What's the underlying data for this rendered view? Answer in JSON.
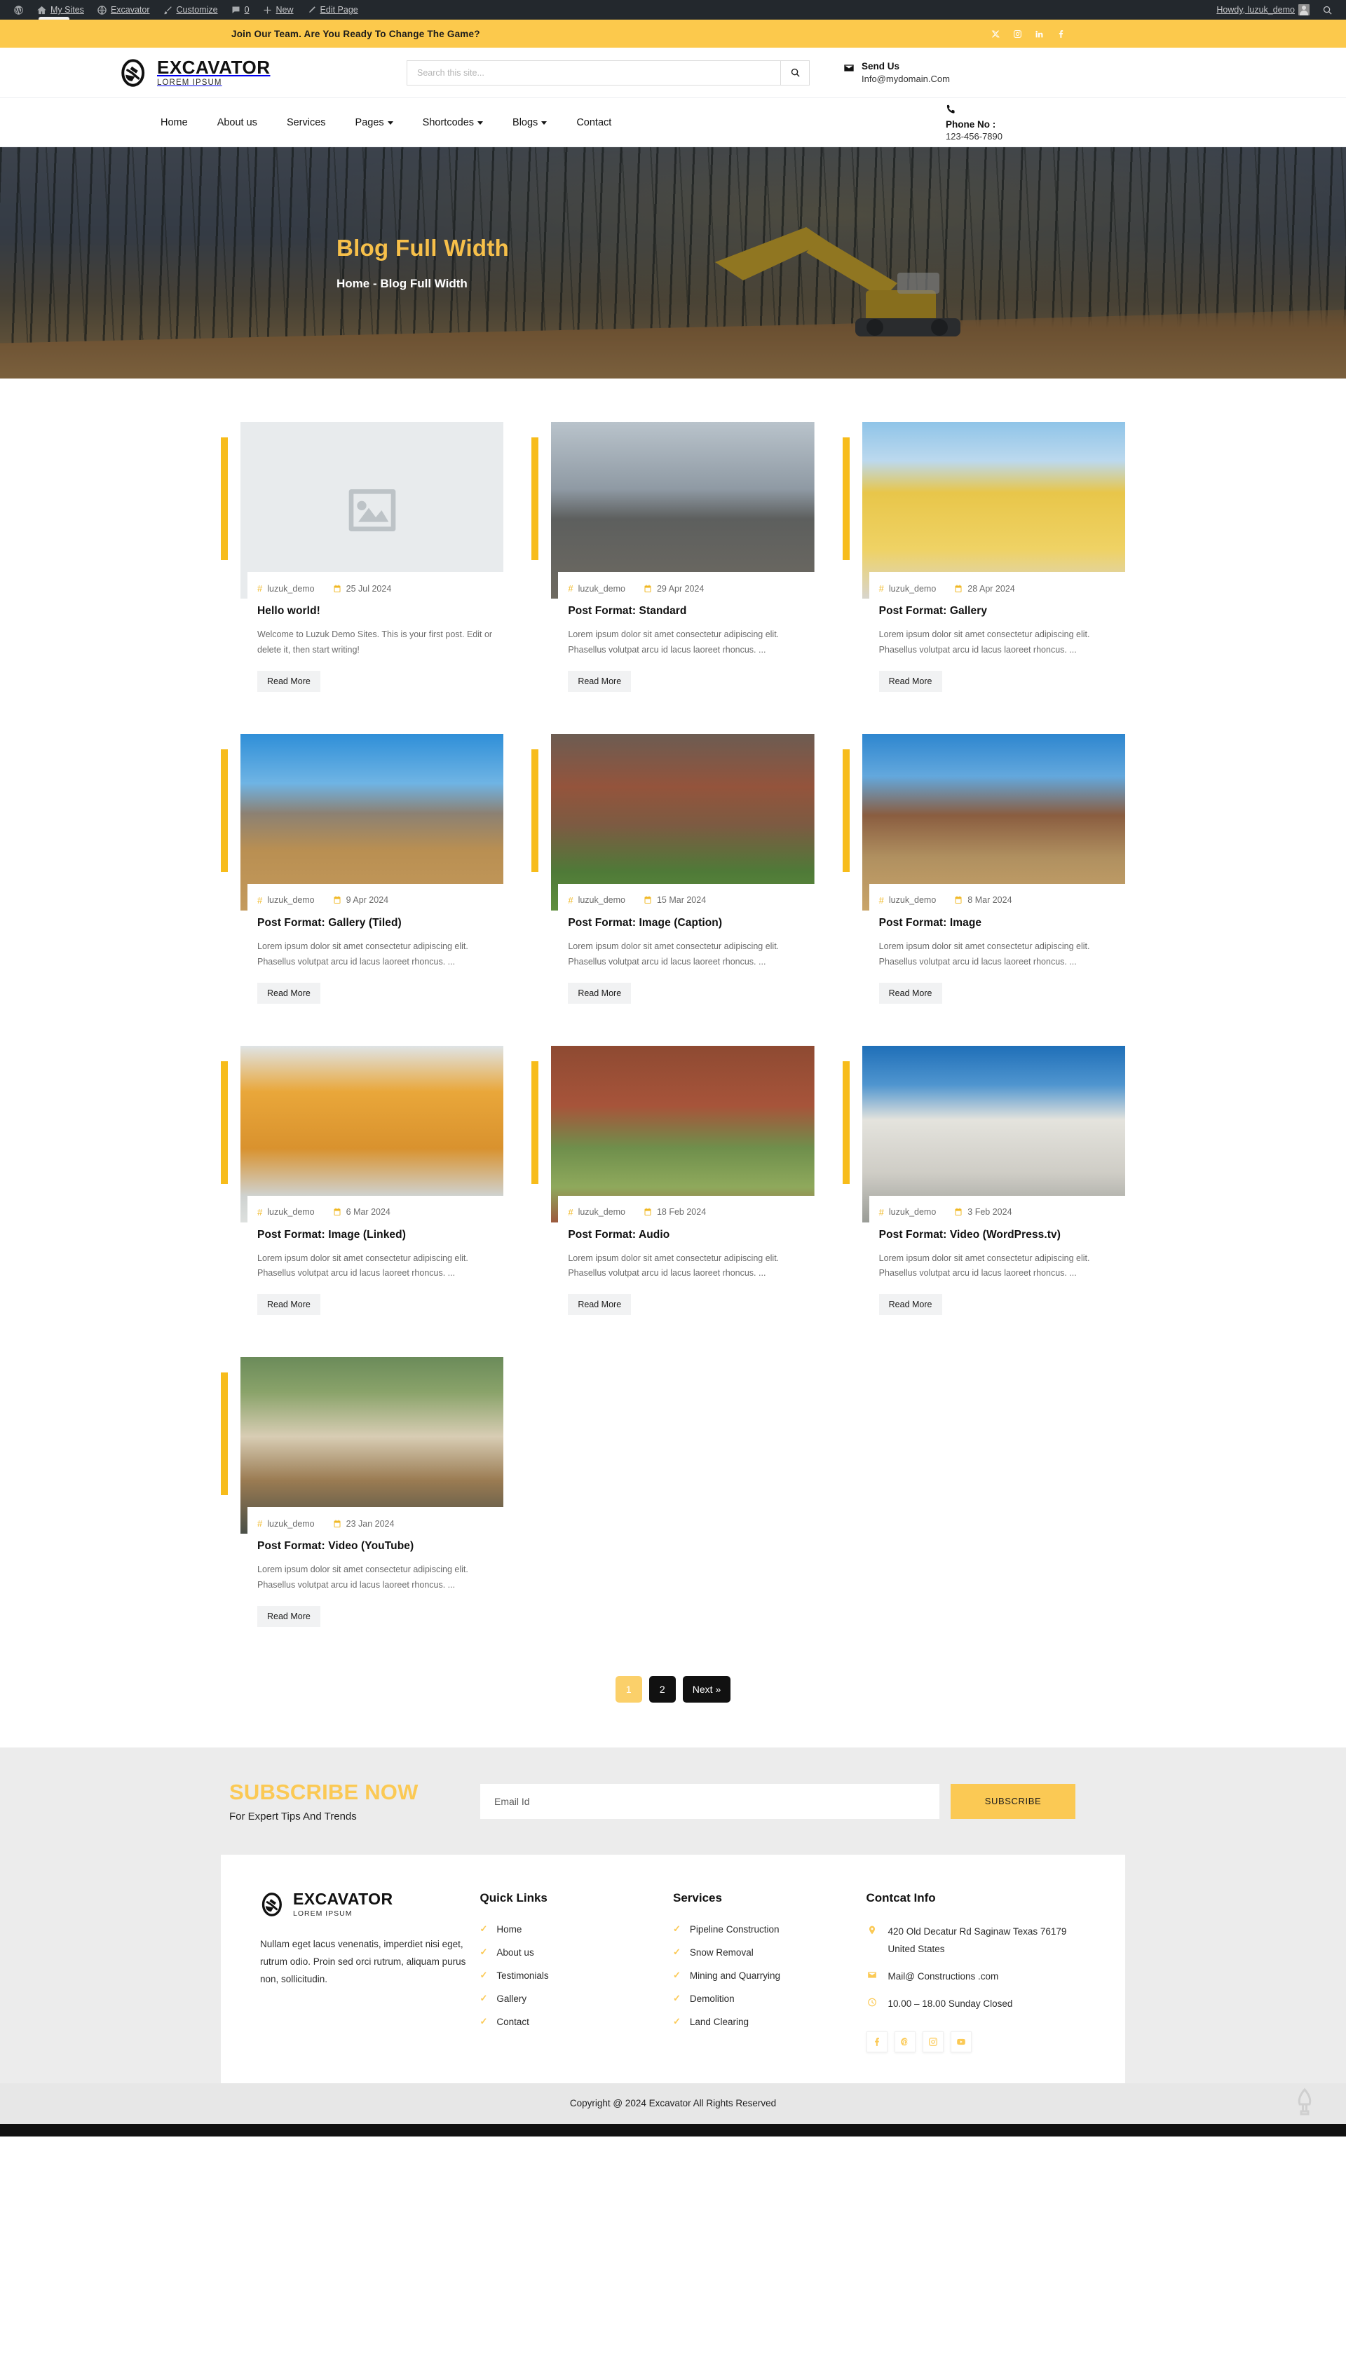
{
  "adminbar": {
    "items": [
      {
        "icon": "wordpress-icon",
        "label": ""
      },
      {
        "icon": "home-icon",
        "label": "My Sites"
      },
      {
        "icon": "site-icon",
        "label": "Excavator"
      },
      {
        "icon": "brush-icon",
        "label": "Customize"
      },
      {
        "icon": "comment-icon",
        "label": "0"
      },
      {
        "icon": "plus-icon",
        "label": "New"
      },
      {
        "icon": "pencil-icon",
        "label": "Edit Page"
      }
    ],
    "howdy": "Howdy, luzuk_demo",
    "search_icon": "search-icon"
  },
  "topbar": {
    "message": "Join Our Team. Are You Ready To Change The Game?",
    "socials": [
      "x-icon",
      "instagram-icon",
      "linkedin-icon",
      "facebook-icon"
    ]
  },
  "header": {
    "brand_name": "EXCAVATOR",
    "brand_sub": "LOREM IPSUM",
    "search_placeholder": "Search this site...",
    "search_value": "",
    "search_icon": "search-icon",
    "email_label": "Send Us",
    "email_value": "Info@mydomain.Com",
    "mail_icon": "envelope-icon"
  },
  "nav": {
    "items": [
      {
        "label": "Home",
        "has_dropdown": false
      },
      {
        "label": "About us",
        "has_dropdown": false
      },
      {
        "label": "Services",
        "has_dropdown": false
      },
      {
        "label": "Pages",
        "has_dropdown": true
      },
      {
        "label": "Shortcodes",
        "has_dropdown": true
      },
      {
        "label": "Blogs",
        "has_dropdown": true
      },
      {
        "label": "Contact",
        "has_dropdown": false
      }
    ],
    "phone_label": "Phone No :",
    "phone_value": "123-456-7890",
    "phone_icon": "phone-icon"
  },
  "hero": {
    "title": "Blog Full Width",
    "breadcrumb": "Home - Blog Full Width"
  },
  "posts": [
    {
      "author": "luzuk_demo",
      "date": "25 Jul 2024",
      "title": "Hello world!",
      "excerpt": "Welcome to Luzuk Demo Sites. This is your first post. Edit or delete it, then start writing!",
      "read_more": "Read More",
      "thumb": "placeholder"
    },
    {
      "author": "luzuk_demo",
      "date": "29 Apr 2024",
      "title": "Post Format: Standard",
      "excerpt": "Lorem ipsum dolor sit amet consectetur adipiscing elit. Phasellus volutpat arcu id lacus laoreet rhoncus. ...",
      "read_more": "Read More",
      "thumb": "construction-workers"
    },
    {
      "author": "luzuk_demo",
      "date": "28 Apr 2024",
      "title": "Post Format: Gallery",
      "excerpt": "Lorem ipsum dolor sit amet consectetur adipiscing elit. Phasellus volutpat arcu id lacus laoreet rhoncus. ...",
      "read_more": "Read More",
      "thumb": "yellow-building"
    },
    {
      "author": "luzuk_demo",
      "date": "9 Apr 2024",
      "title": "Post Format: Gallery (Tiled)",
      "excerpt": "Lorem ipsum dolor sit amet consectetur adipiscing elit. Phasellus volutpat arcu id lacus laoreet rhoncus. ...",
      "read_more": "Read More",
      "thumb": "grey-house"
    },
    {
      "author": "luzuk_demo",
      "date": "15 Mar 2024",
      "title": "Post Format: Image (Caption)",
      "excerpt": "Lorem ipsum dolor sit amet consectetur adipiscing elit. Phasellus volutpat arcu id lacus laoreet rhoncus. ...",
      "read_more": "Read More",
      "thumb": "brick-houses"
    },
    {
      "author": "luzuk_demo",
      "date": "8 Mar 2024",
      "title": "Post Format: Image",
      "excerpt": "Lorem ipsum dolor sit amet consectetur adipiscing elit. Phasellus volutpat arcu id lacus laoreet rhoncus. ...",
      "read_more": "Read More",
      "thumb": "stone-house"
    },
    {
      "author": "luzuk_demo",
      "date": "6 Mar 2024",
      "title": "Post Format: Image (Linked)",
      "excerpt": "Lorem ipsum dolor sit amet consectetur adipiscing elit. Phasellus volutpat arcu id lacus laoreet rhoncus. ...",
      "read_more": "Read More",
      "thumb": "orange-villa"
    },
    {
      "author": "luzuk_demo",
      "date": "18 Feb 2024",
      "title": "Post Format: Audio",
      "excerpt": "Lorem ipsum dolor sit amet consectetur adipiscing elit. Phasellus volutpat arcu id lacus laoreet rhoncus. ...",
      "read_more": "Read More",
      "thumb": "red-brick-gate"
    },
    {
      "author": "luzuk_demo",
      "date": "3 Feb 2024",
      "title": "Post Format: Video (WordPress.tv)",
      "excerpt": "Lorem ipsum dolor sit amet consectetur adipiscing elit. Phasellus volutpat arcu id lacus laoreet rhoncus. ...",
      "read_more": "Read More",
      "thumb": "white-tower-house"
    },
    {
      "author": "luzuk_demo",
      "date": "23 Jan 2024",
      "title": "Post Format: Video (YouTube)",
      "excerpt": "Lorem ipsum dolor sit amet consectetur adipiscing elit. Phasellus volutpat arcu id lacus laoreet rhoncus. ...",
      "read_more": "Read More",
      "thumb": "green-house"
    }
  ],
  "pagination": {
    "pages": [
      "1",
      "2"
    ],
    "next_label": "Next »",
    "current": "1"
  },
  "subscribe": {
    "title": "SUBSCRIBE NOW",
    "subtitle": "For Expert Tips And Trends",
    "placeholder": "Email Id",
    "value": "",
    "button": "SUBSCRIBE"
  },
  "footer": {
    "brand_name": "EXCAVATOR",
    "brand_sub": "LOREM IPSUM",
    "about": "Nullam eget lacus venenatis, imperdiet nisi eget, rutrum odio. Proin sed orci rutrum, aliquam purus non, sollicitudin.",
    "quick_links_title": "Quick Links",
    "quick_links": [
      "Home",
      "About us",
      "Testimonials",
      "Gallery",
      "Contact"
    ],
    "services_title": "Services",
    "services": [
      "Pipeline Construction",
      "Snow Removal",
      "Mining and Quarrying",
      "Demolition",
      "Land Clearing"
    ],
    "contact_title": "Contcat Info",
    "address": "420 Old Decatur Rd Saginaw Texas 76179 United States",
    "email": "Mail@ Constructions .com",
    "hours": "10.00 – 18.00 Sunday Closed",
    "socials": [
      "facebook-icon",
      "pinterest-icon",
      "instagram-icon",
      "youtube-icon"
    ]
  },
  "copyright": "Copyright @ 2024 Excavator All Rights Reserved",
  "colors": {
    "accent": "#f7bc1b",
    "topbar": "#fcc94c",
    "hero_title": "#f7c04a",
    "dark": "#111111"
  }
}
